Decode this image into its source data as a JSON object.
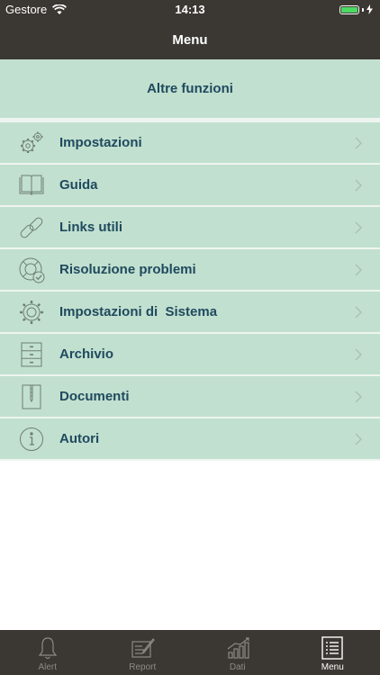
{
  "status_bar": {
    "carrier": "Gestore",
    "time": "14:13"
  },
  "nav": {
    "title": "Menu"
  },
  "section": {
    "title": "Altre funzioni"
  },
  "menu_items": [
    {
      "label": "Impostazioni",
      "icon": "gears-icon"
    },
    {
      "label": "Guida",
      "icon": "book-icon"
    },
    {
      "label": "Links utili",
      "icon": "link-icon"
    },
    {
      "label": "Risoluzione problemi",
      "icon": "lifebuoy-icon"
    },
    {
      "label": "Impostazioni di  Sistema",
      "icon": "gear-icon"
    },
    {
      "label": "Archivio",
      "icon": "cabinet-icon"
    },
    {
      "label": "Documenti",
      "icon": "document-icon"
    },
    {
      "label": "Autori",
      "icon": "info-icon"
    }
  ],
  "tabs": [
    {
      "label": "Alert",
      "icon": "bell-icon",
      "active": false
    },
    {
      "label": "Report",
      "icon": "report-icon",
      "active": false
    },
    {
      "label": "Dati",
      "icon": "chart-icon",
      "active": false
    },
    {
      "label": "Menu",
      "icon": "menu-list-icon",
      "active": true
    }
  ],
  "colors": {
    "bar_background": "#3b3732",
    "row_background": "#c2e0cf",
    "text": "#1f4a5f",
    "tab_active": "#ffffff",
    "tab_inactive": "#8d8a86"
  }
}
